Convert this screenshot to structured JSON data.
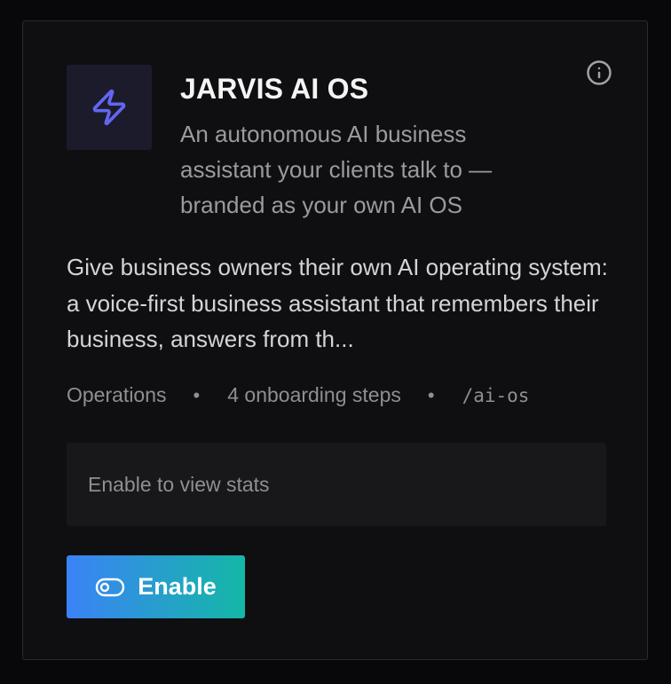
{
  "card": {
    "title": "JARVIS AI OS",
    "subtitle": "An autonomous AI business assistant your clients talk to — branded as your own AI OS",
    "description": "Give business owners their own AI operating system: a voice-first business assistant that remembers their business, answers from th...",
    "icon": "lightning-bolt-icon",
    "accent_color": "#6366f1",
    "meta": {
      "category": "Operations",
      "separator": "•",
      "steps": "4 onboarding steps",
      "route": "/ai-os"
    },
    "stats_placeholder": "Enable to view stats",
    "enable_label": "Enable"
  }
}
